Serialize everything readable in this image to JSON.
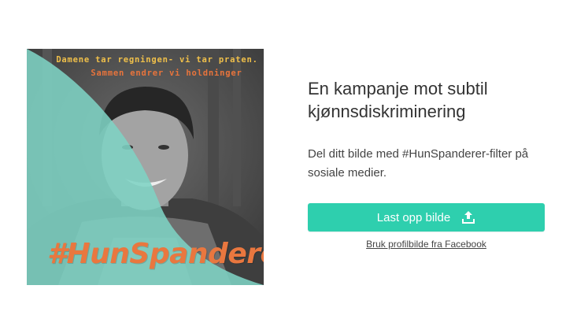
{
  "preview": {
    "caption_line1": "Damene tar regningen- vi tar praten.",
    "caption_line2": "Sammen endrer vi holdninger",
    "hashtag": "#HunSpanderer",
    "overlay_color": "#7ed3c4",
    "text_accent_color": "#e9773f",
    "photo_description_icon": "portrait-photo"
  },
  "panel": {
    "heading": "En kampanje mot subtil kjønnsdiskriminering",
    "description": "Del ditt bilde med #HunSpanderer-filter på sosiale medier.",
    "upload_button_label": "Last opp bilde",
    "upload_icon": "upload-icon",
    "facebook_link": "Bruk profilbilde fra Facebook",
    "accent_color": "#2ecfae"
  }
}
